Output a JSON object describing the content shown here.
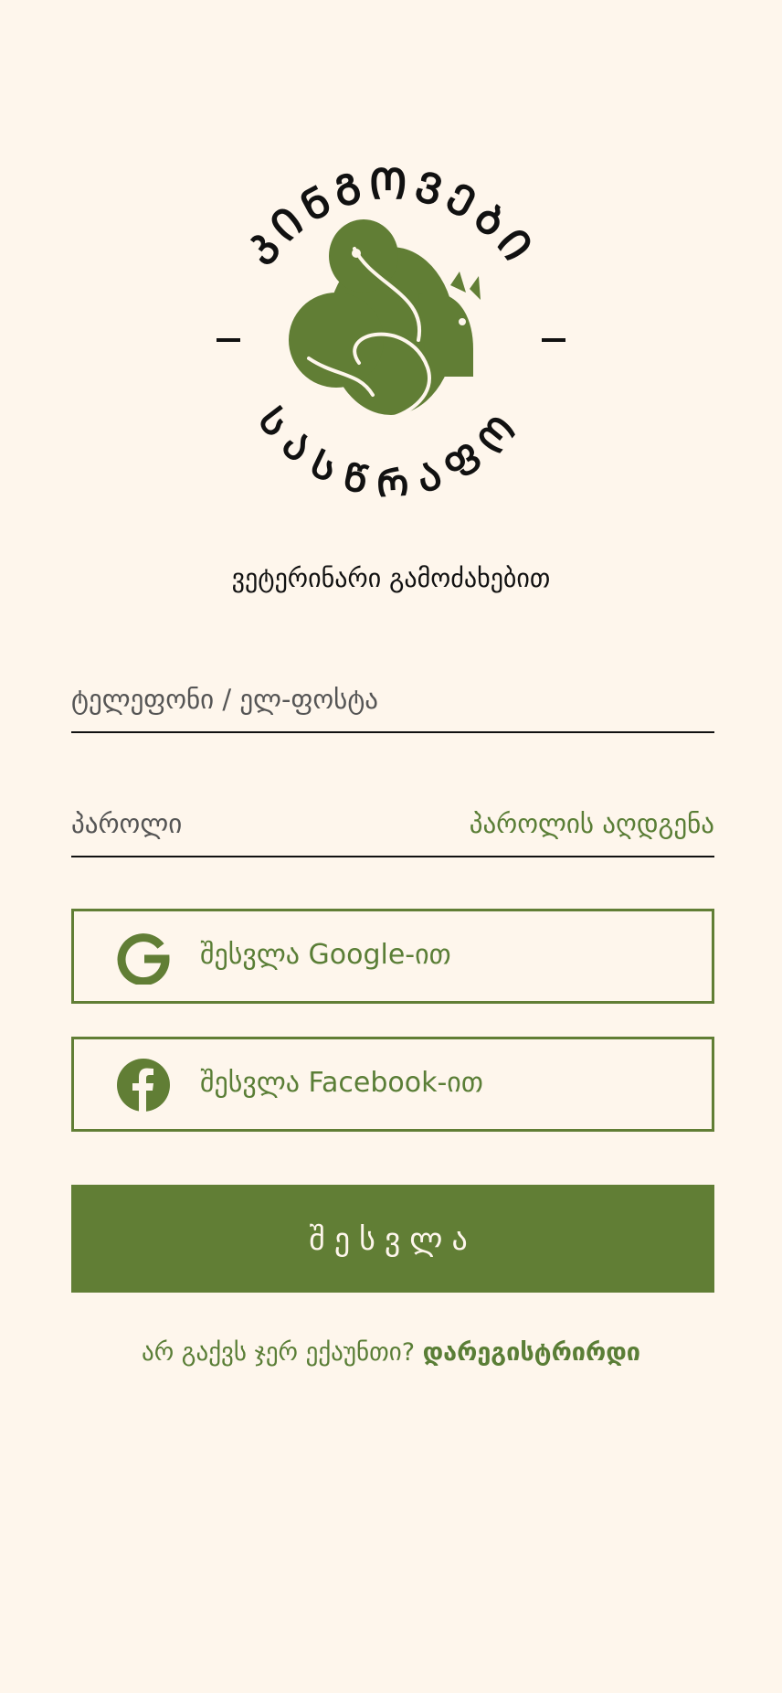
{
  "brand": {
    "ring_top_text": "ᲙᲘᲜᲒᲝᲕᲔᲑᲘ",
    "ring_bottom_text": "ᲡᲐᲡᲬᲠᲐᲤᲝ",
    "accent_color": "#617e35",
    "logo_icon": "pet-logo-icon"
  },
  "tagline": "ვეტერინარი გამოძახებით",
  "form": {
    "phone_placeholder": "ტელეფონი / ელ-ფოსტა",
    "password_placeholder": "პაროლი",
    "forgot_password": "პაროლის აღდგენა"
  },
  "social": {
    "google_label": "შესვლა Google-ით",
    "google_icon": "google-icon",
    "facebook_label": "შესვლა Facebook-ით",
    "facebook_icon": "facebook-icon"
  },
  "login_button": "შესვლა",
  "register": {
    "prompt": "არ გაქვს ჯერ ექაუნთი?",
    "link": "დარეგისტრირდი"
  }
}
